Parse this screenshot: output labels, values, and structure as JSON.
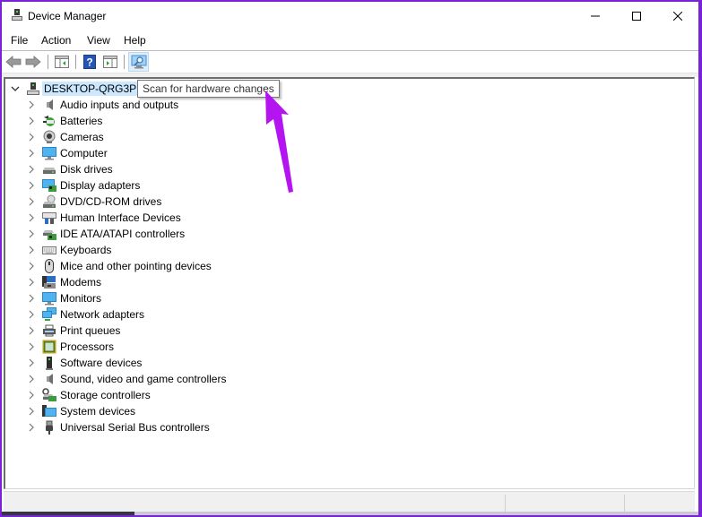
{
  "window": {
    "title": "Device Manager",
    "app_icon": "device-manager-icon",
    "controls": {
      "minimize": "minimize-icon",
      "maximize": "maximize-icon",
      "close": "close-icon"
    }
  },
  "menu": [
    "File",
    "Action",
    "View",
    "Help"
  ],
  "toolbar": {
    "buttons": [
      {
        "name": "back",
        "icon": "back-arrow-icon"
      },
      {
        "name": "forward",
        "icon": "forward-arrow-icon"
      },
      {
        "name": "show-hide-console-tree",
        "icon": "console-tree-icon"
      },
      {
        "name": "help",
        "icon": "help-icon"
      },
      {
        "name": "show-hide-action-pane",
        "icon": "action-pane-icon"
      },
      {
        "name": "scan-hardware",
        "icon": "scan-monitor-icon",
        "active": true
      }
    ]
  },
  "tooltip": "Scan for hardware changes",
  "tree": {
    "root": {
      "label": "DESKTOP-QRG3PDN",
      "expanded": true,
      "icon": "computer-tower-icon"
    },
    "categories": [
      {
        "label": "Audio inputs and outputs",
        "icon": "speaker-icon"
      },
      {
        "label": "Batteries",
        "icon": "battery-icon"
      },
      {
        "label": "Cameras",
        "icon": "camera-icon"
      },
      {
        "label": "Computer",
        "icon": "monitor-icon"
      },
      {
        "label": "Disk drives",
        "icon": "disk-drive-icon"
      },
      {
        "label": "Display adapters",
        "icon": "display-adapter-icon"
      },
      {
        "label": "DVD/CD-ROM drives",
        "icon": "dvd-drive-icon"
      },
      {
        "label": "Human Interface Devices",
        "icon": "hid-icon"
      },
      {
        "label": "IDE ATA/ATAPI controllers",
        "icon": "ide-controller-icon"
      },
      {
        "label": "Keyboards",
        "icon": "keyboard-icon"
      },
      {
        "label": "Mice and other pointing devices",
        "icon": "mouse-icon"
      },
      {
        "label": "Modems",
        "icon": "modem-icon"
      },
      {
        "label": "Monitors",
        "icon": "monitor-icon"
      },
      {
        "label": "Network adapters",
        "icon": "network-adapter-icon"
      },
      {
        "label": "Print queues",
        "icon": "printer-icon"
      },
      {
        "label": "Processors",
        "icon": "processor-icon"
      },
      {
        "label": "Software devices",
        "icon": "software-device-icon"
      },
      {
        "label": "Sound, video and game controllers",
        "icon": "speaker-icon"
      },
      {
        "label": "Storage controllers",
        "icon": "storage-controller-icon"
      },
      {
        "label": "System devices",
        "icon": "system-devices-icon"
      },
      {
        "label": "Universal Serial Bus controllers",
        "icon": "usb-icon"
      }
    ]
  },
  "annotation": {
    "type": "arrow",
    "color": "#b414f0",
    "points_to": "scan-hardware-button"
  },
  "colors": {
    "frame": "#7a22d6",
    "selection": "#cce8ff",
    "arrow": "#b414f0"
  }
}
